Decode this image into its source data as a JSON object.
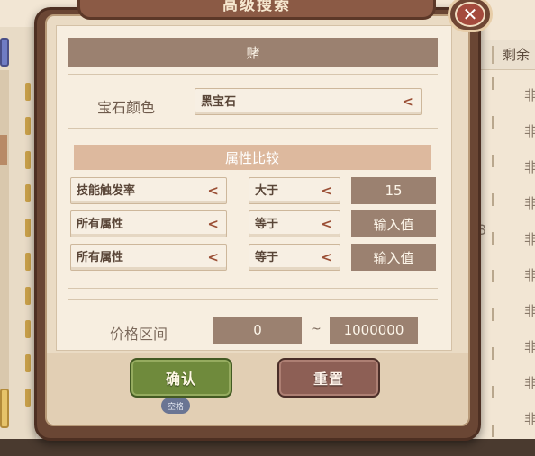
{
  "background": {
    "header_text": "剩余",
    "right_values": [
      "非",
      "非",
      "非",
      "非",
      "非",
      "非",
      "非",
      "非",
      "非",
      "非"
    ],
    "stray_digit": "3"
  },
  "modal": {
    "title": "高级搜索",
    "close_icon": "close-icon",
    "section_header": "赌",
    "gem_color": {
      "label": "宝石颜色",
      "value": "黑宝石",
      "arrow": "<"
    },
    "attribute_compare": {
      "header": "属性比较",
      "rows": [
        {
          "attribute": "技能触发率",
          "operator": "大于",
          "value": "15"
        },
        {
          "attribute": "所有属性",
          "operator": "等于",
          "value": "输入值"
        },
        {
          "attribute": "所有属性",
          "operator": "等于",
          "value": "输入值"
        }
      ],
      "arrow": "<"
    },
    "price_range": {
      "label": "价格区间",
      "min": "0",
      "separator": "~",
      "max": "1000000"
    },
    "buttons": {
      "confirm": "确认",
      "confirm_hint": "空格",
      "reset": "重置"
    }
  },
  "colors": {
    "frame": "#6a4634",
    "panel": "#f7eee0",
    "header_bar": "#9b8170",
    "accent_arrow": "#9a4e34",
    "confirm_green": "#6f8a3c",
    "reset_brown": "#8d5f55"
  }
}
